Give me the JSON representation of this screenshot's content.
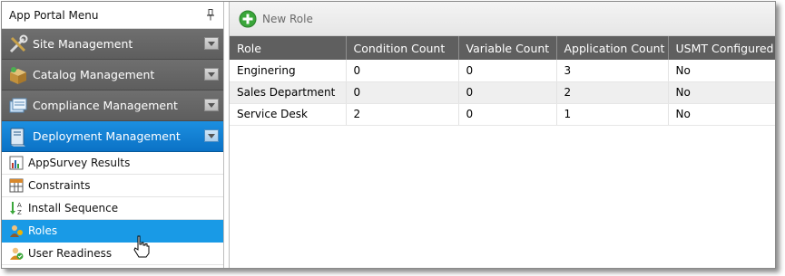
{
  "nav": {
    "title": "App Portal Menu",
    "sections": [
      {
        "label": "Site Management",
        "icon": "tools-icon",
        "active": false
      },
      {
        "label": "Catalog Management",
        "icon": "package-icon",
        "active": false
      },
      {
        "label": "Compliance Management",
        "icon": "compliance-icon",
        "active": false
      },
      {
        "label": "Deployment Management",
        "icon": "deployment-icon",
        "active": true
      }
    ],
    "sub_items": [
      {
        "label": "AppSurvey Results",
        "icon": "chart-icon"
      },
      {
        "label": "Constraints",
        "icon": "grid-icon"
      },
      {
        "label": "Install Sequence",
        "icon": "sort-az-icon"
      },
      {
        "label": "Roles",
        "icon": "roles-icon",
        "selected": true
      },
      {
        "label": "User Readiness",
        "icon": "user-readiness-icon"
      }
    ]
  },
  "toolbar": {
    "new_role_label": "New Role"
  },
  "grid": {
    "columns": [
      "Role",
      "Condition Count",
      "Variable Count",
      "Application Count",
      "USMT Configured"
    ],
    "rows": [
      [
        "Enginering",
        "0",
        "0",
        "3",
        "No"
      ],
      [
        "Sales Department",
        "0",
        "0",
        "2",
        "No"
      ],
      [
        "Service Desk",
        "2",
        "0",
        "1",
        "No"
      ]
    ]
  },
  "colors": {
    "section_bg": "#666666",
    "active_section_bg": "#0b72c6",
    "selected_item_bg": "#199ae6",
    "grid_header_bg": "#5f5f5f",
    "add_green": "#3aa63a"
  }
}
